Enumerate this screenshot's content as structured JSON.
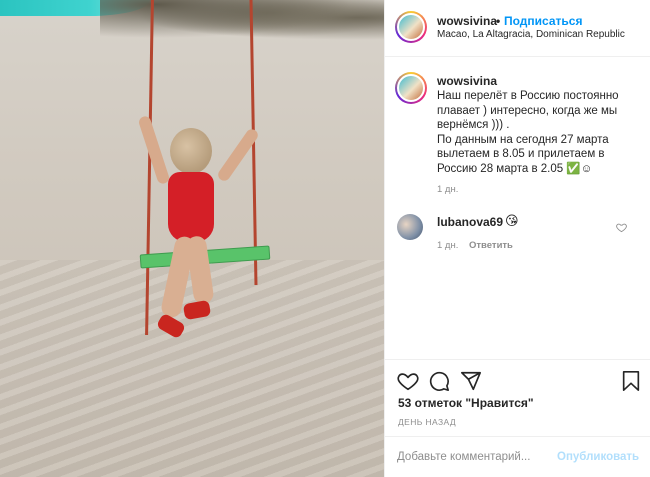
{
  "post": {
    "username": "wowsivina",
    "separator": "•",
    "follow_label": "Подписаться",
    "location": "Macao, La Altagracia, Dominican Republic"
  },
  "caption": {
    "username": "wowsivina",
    "text": "Наш перелёт в Россию постоянно\nплавает ) интересно, когда же мы\nвернёмся ))) .\nПо данным на сегодня 27 марта\nвылетаем в 8.05 и прилетаем в\nРоссию 28 марта в 2.05 ✅☺",
    "time": "1 дн."
  },
  "comment": {
    "username": "lubanova69",
    "emoji": "😘",
    "time": "1 дн.",
    "reply_label": "Ответить"
  },
  "actions": {
    "icons": [
      "heart-icon",
      "comment-icon",
      "share-icon",
      "bookmark-icon"
    ],
    "likes": "53 отметок \"Нравится\"",
    "posted": "ДЕНЬ НАЗАД"
  },
  "add_comment": {
    "placeholder": "Добавьте комментарий...",
    "publish_label": "Опубликовать"
  },
  "colors": {
    "accent": "#0095f6",
    "publish_disabled": "#b2dffc",
    "muted": "#8e8e8e",
    "text": "#262626"
  }
}
